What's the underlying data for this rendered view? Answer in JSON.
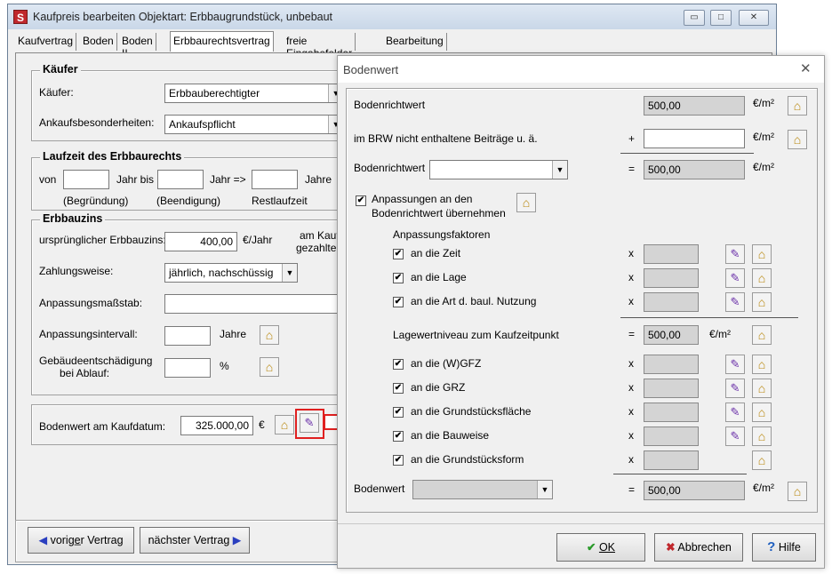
{
  "window": {
    "title": "Kaufpreis bearbeiten  Objektart: Erbbaugrundstück, unbebaut",
    "app_icon": "S",
    "minimize_icon": "▭",
    "maximize_icon": "□",
    "close_icon": "✕"
  },
  "tabs": [
    {
      "label": "Kaufvertrag"
    },
    {
      "label": "Boden"
    },
    {
      "label": "Boden II"
    },
    {
      "label": "Erbbaurechtsvertrag",
      "active": true
    },
    {
      "label": "freie Eingabefelder"
    },
    {
      "label": "Bearbeitung"
    }
  ],
  "kaeufer": {
    "title": "Käufer",
    "kaeufer_label": "Käufer:",
    "kaeufer_value": "Erbbauberechtigter",
    "ankauf_label": "Ankaufsbesonderheiten:",
    "ankauf_value": "Ankaufspflicht"
  },
  "laufzeit": {
    "title": "Laufzeit des Erbbaurechts",
    "von": "von",
    "jahr_bis": "Jahr bis",
    "jahr_arrow": "Jahr =>",
    "jahre": "Jahre",
    "begruendung": "(Begründung)",
    "beendigung": "(Beendigung)",
    "restlaufzeit": "Restlaufzeit"
  },
  "erbbauzins": {
    "title": "Erbbauzins",
    "urspr_label": "ursprünglicher Erbbauzins:",
    "urspr_value": "400,00",
    "urspr_unit": "€/Jahr",
    "kauf_line1": "am Kauf",
    "kauf_line2": "gezahlte",
    "zahlungsweise_label": "Zahlungsweise:",
    "zahlungsweise_value": "jährlich, nachschüssig",
    "massstab_label": "Anpassungsmaßstab:",
    "intervall_label": "Anpassungsintervall:",
    "intervall_unit": "Jahre",
    "gebaeude_line1": "Gebäudeentschädigung",
    "gebaeude_line2": "bei Ablauf:",
    "gebaeude_unit": "%"
  },
  "bodenwert_kauf": {
    "label": "Bodenwert am Kaufdatum:",
    "value": "325.000,00",
    "unit": "€"
  },
  "nav": {
    "prev_label": "vorige̲r Vertrag",
    "next_label": "nächster Vertrag",
    "prev_icon": "◀",
    "next_icon": "▶"
  },
  "dialog": {
    "title": "Bodenwert",
    "close_icon": "✕",
    "brw_label": "Bodenrichtwert",
    "brw_value": "500,00",
    "unit_m2": "€/m²",
    "beitraege_label": "im BRW nicht enthaltene Beiträge u. ä.",
    "plus": "+",
    "brw2_label": "Bodenrichtwert",
    "eq": "=",
    "brw2_value": "500,00",
    "anpassungen_line1": "Anpassungen an den",
    "anpassungen_line2": "Bodenrichtwert übernehmen",
    "faktoren_label": "Anpassungsfaktoren",
    "times": "x",
    "factors_a": [
      {
        "label": "an die Zeit"
      },
      {
        "label": "an die Lage"
      },
      {
        "label": "an die Art d. baul. Nutzung"
      }
    ],
    "lagewert_label": "Lagewertniveau zum Kaufzeitpunkt",
    "lagewert_value": "500,00",
    "factors_b": [
      {
        "label": "an die (W)GFZ"
      },
      {
        "label": "an die GRZ"
      },
      {
        "label": "an die Grundstücksfläche"
      },
      {
        "label": "an die Bauweise"
      },
      {
        "label": "an die Grundstücksform"
      }
    ],
    "bodenwert_label": "Bodenwert",
    "bodenwert_value": "500,00",
    "ok_label": "OK",
    "cancel_label": "Abbrechen",
    "help_label": "Hilfe",
    "ok_icon": "✔",
    "cancel_icon": "✖",
    "help_icon": "?"
  },
  "colors": {
    "accent_red": "#e02020",
    "ok_green": "#2a9a2a",
    "cancel_red": "#c0282d",
    "help_blue": "#1f5fbf"
  }
}
